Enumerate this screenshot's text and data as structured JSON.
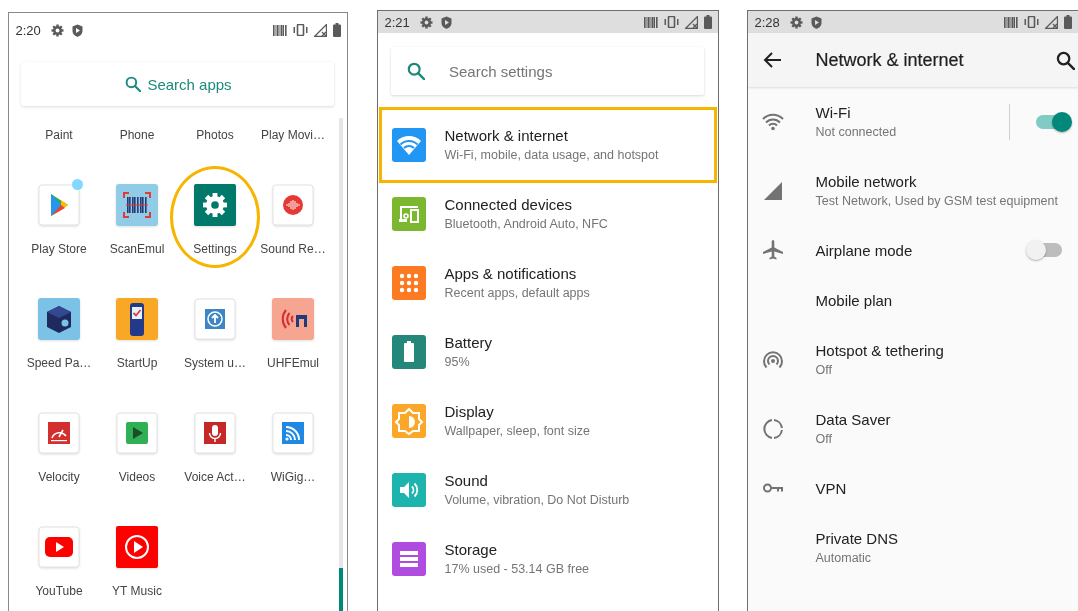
{
  "app_drawer": {
    "status_bar": {
      "time": "2:20"
    },
    "search": {
      "placeholder": "Search apps"
    },
    "apps": [
      {
        "label": "Paint",
        "highlighted": false,
        "badge": false
      },
      {
        "label": "Phone",
        "highlighted": false,
        "badge": false
      },
      {
        "label": "Photos",
        "highlighted": false,
        "badge": false
      },
      {
        "label": "Play Movi…",
        "highlighted": false,
        "badge": false
      },
      {
        "label": "Play Store",
        "highlighted": false,
        "badge": true
      },
      {
        "label": "ScanEmul",
        "highlighted": false,
        "badge": false
      },
      {
        "label": "Settings",
        "highlighted": true,
        "badge": false
      },
      {
        "label": "Sound Re…",
        "highlighted": false,
        "badge": false
      },
      {
        "label": "Speed Pa…",
        "highlighted": false,
        "badge": false
      },
      {
        "label": "StartUp",
        "highlighted": false,
        "badge": false
      },
      {
        "label": "System u…",
        "highlighted": false,
        "badge": false
      },
      {
        "label": "UHFEmul",
        "highlighted": false,
        "badge": false
      },
      {
        "label": "Velocity",
        "highlighted": false,
        "badge": false
      },
      {
        "label": "Videos",
        "highlighted": false,
        "badge": false
      },
      {
        "label": "Voice Act…",
        "highlighted": false,
        "badge": false
      },
      {
        "label": "WiGig…",
        "highlighted": false,
        "badge": false
      },
      {
        "label": "YouTube",
        "highlighted": false,
        "badge": false
      },
      {
        "label": "YT Music",
        "highlighted": false,
        "badge": false
      }
    ]
  },
  "settings": {
    "status_bar": {
      "time": "2:21"
    },
    "search": {
      "placeholder": "Search settings"
    },
    "items": [
      {
        "title": "Network & internet",
        "summary": "Wi-Fi, mobile, data usage, and hotspot",
        "color": "#2196f3",
        "highlighted": true
      },
      {
        "title": "Connected devices",
        "summary": "Bluetooth, Android Auto, NFC",
        "color": "#7cb82f",
        "highlighted": false
      },
      {
        "title": "Apps & notifications",
        "summary": "Recent apps, default apps",
        "color": "#fb7a22",
        "highlighted": false
      },
      {
        "title": "Battery",
        "summary": "95%",
        "color": "#25877a",
        "highlighted": false
      },
      {
        "title": "Display",
        "summary": "Wallpaper, sleep, font size",
        "color": "#fba72a",
        "highlighted": false
      },
      {
        "title": "Sound",
        "summary": "Volume, vibration, Do Not Disturb",
        "color": "#1cb4ac",
        "highlighted": false
      },
      {
        "title": "Storage",
        "summary": "17% used - 53.14 GB free",
        "color": "#b04de0",
        "highlighted": false
      }
    ]
  },
  "network_settings": {
    "status_bar": {
      "time": "2:28"
    },
    "title": "Network & internet",
    "items": [
      {
        "title": "Wi-Fi",
        "summary": "Not connected",
        "kind": "split-toggle",
        "on": true
      },
      {
        "title": "Mobile network",
        "summary": "Test Network, Used by GSM test equipment",
        "kind": "plain"
      },
      {
        "title": "Airplane mode",
        "kind": "toggle",
        "on": false
      },
      {
        "title": "Mobile plan",
        "kind": "plain"
      },
      {
        "title": "Hotspot & tethering",
        "summary": "Off",
        "kind": "plain"
      },
      {
        "title": "Data Saver",
        "summary": "Off",
        "kind": "plain"
      },
      {
        "title": "VPN",
        "kind": "plain"
      },
      {
        "title": "Private DNS",
        "summary": "Automatic",
        "kind": "plain"
      }
    ]
  }
}
